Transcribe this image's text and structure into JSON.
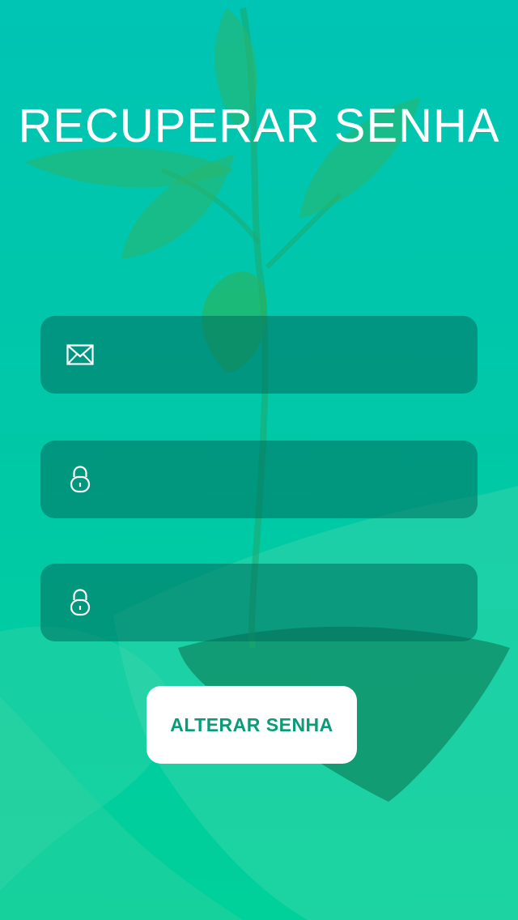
{
  "header": {
    "title": "RECUPERAR SENHA"
  },
  "form": {
    "email": {
      "icon": "envelope-icon",
      "value": "",
      "placeholder": ""
    },
    "password": {
      "icon": "lock-icon",
      "value": "",
      "placeholder": ""
    },
    "confirm_password": {
      "icon": "lock-icon",
      "value": "",
      "placeholder": ""
    },
    "submit_label": "ALTERAR SENHA"
  },
  "colors": {
    "background_top": "#00c4b4",
    "background_bottom": "#00d09a",
    "field_background": "#00806e",
    "button_background": "#ffffff",
    "button_text": "#0a9b78"
  }
}
